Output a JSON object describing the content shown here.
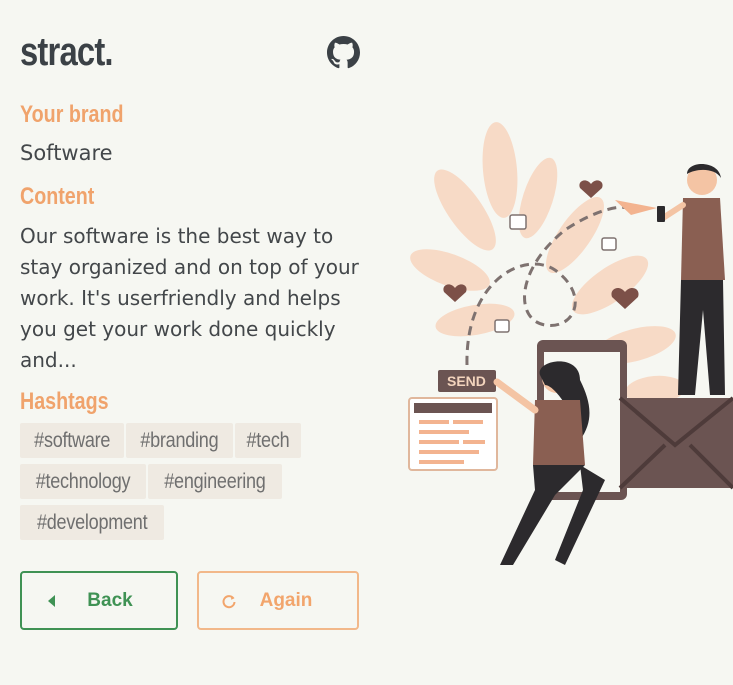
{
  "app": {
    "logo": "stract."
  },
  "brand": {
    "label": "Your brand",
    "value": "Software"
  },
  "content": {
    "label": "Content",
    "text": "Our software is the best way to stay organized and on top of your work. It's userfriendly and helps you get your work done quickly and..."
  },
  "hashtags": {
    "label": "Hashtags",
    "items": [
      "#software",
      "#branding",
      "#tech",
      "#technology",
      "#engineering",
      "#development"
    ]
  },
  "buttons": {
    "back": "Back",
    "again": "Again"
  },
  "illustration": {
    "send_label": "SEND"
  },
  "colors": {
    "accent": "#f0a36c",
    "back_green": "#3f9254",
    "text": "#43474a",
    "tag_bg": "#efeae2"
  },
  "icons": [
    "github-icon",
    "caret-left-icon",
    "refresh-icon"
  ]
}
